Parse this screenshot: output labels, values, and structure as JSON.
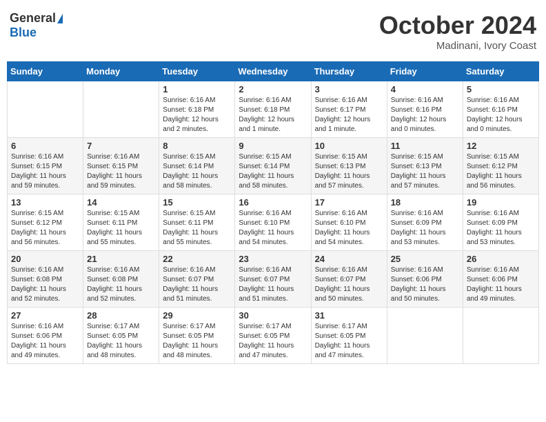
{
  "header": {
    "logo_general": "General",
    "logo_blue": "Blue",
    "month_title": "October 2024",
    "location": "Madinani, Ivory Coast"
  },
  "weekdays": [
    "Sunday",
    "Monday",
    "Tuesday",
    "Wednesday",
    "Thursday",
    "Friday",
    "Saturday"
  ],
  "weeks": [
    [
      {
        "day": "",
        "info": ""
      },
      {
        "day": "",
        "info": ""
      },
      {
        "day": "1",
        "info": "Sunrise: 6:16 AM\nSunset: 6:18 PM\nDaylight: 12 hours\nand 2 minutes."
      },
      {
        "day": "2",
        "info": "Sunrise: 6:16 AM\nSunset: 6:18 PM\nDaylight: 12 hours\nand 1 minute."
      },
      {
        "day": "3",
        "info": "Sunrise: 6:16 AM\nSunset: 6:17 PM\nDaylight: 12 hours\nand 1 minute."
      },
      {
        "day": "4",
        "info": "Sunrise: 6:16 AM\nSunset: 6:16 PM\nDaylight: 12 hours\nand 0 minutes."
      },
      {
        "day": "5",
        "info": "Sunrise: 6:16 AM\nSunset: 6:16 PM\nDaylight: 12 hours\nand 0 minutes."
      }
    ],
    [
      {
        "day": "6",
        "info": "Sunrise: 6:16 AM\nSunset: 6:15 PM\nDaylight: 11 hours\nand 59 minutes."
      },
      {
        "day": "7",
        "info": "Sunrise: 6:16 AM\nSunset: 6:15 PM\nDaylight: 11 hours\nand 59 minutes."
      },
      {
        "day": "8",
        "info": "Sunrise: 6:15 AM\nSunset: 6:14 PM\nDaylight: 11 hours\nand 58 minutes."
      },
      {
        "day": "9",
        "info": "Sunrise: 6:15 AM\nSunset: 6:14 PM\nDaylight: 11 hours\nand 58 minutes."
      },
      {
        "day": "10",
        "info": "Sunrise: 6:15 AM\nSunset: 6:13 PM\nDaylight: 11 hours\nand 57 minutes."
      },
      {
        "day": "11",
        "info": "Sunrise: 6:15 AM\nSunset: 6:13 PM\nDaylight: 11 hours\nand 57 minutes."
      },
      {
        "day": "12",
        "info": "Sunrise: 6:15 AM\nSunset: 6:12 PM\nDaylight: 11 hours\nand 56 minutes."
      }
    ],
    [
      {
        "day": "13",
        "info": "Sunrise: 6:15 AM\nSunset: 6:12 PM\nDaylight: 11 hours\nand 56 minutes."
      },
      {
        "day": "14",
        "info": "Sunrise: 6:15 AM\nSunset: 6:11 PM\nDaylight: 11 hours\nand 55 minutes."
      },
      {
        "day": "15",
        "info": "Sunrise: 6:15 AM\nSunset: 6:11 PM\nDaylight: 11 hours\nand 55 minutes."
      },
      {
        "day": "16",
        "info": "Sunrise: 6:16 AM\nSunset: 6:10 PM\nDaylight: 11 hours\nand 54 minutes."
      },
      {
        "day": "17",
        "info": "Sunrise: 6:16 AM\nSunset: 6:10 PM\nDaylight: 11 hours\nand 54 minutes."
      },
      {
        "day": "18",
        "info": "Sunrise: 6:16 AM\nSunset: 6:09 PM\nDaylight: 11 hours\nand 53 minutes."
      },
      {
        "day": "19",
        "info": "Sunrise: 6:16 AM\nSunset: 6:09 PM\nDaylight: 11 hours\nand 53 minutes."
      }
    ],
    [
      {
        "day": "20",
        "info": "Sunrise: 6:16 AM\nSunset: 6:08 PM\nDaylight: 11 hours\nand 52 minutes."
      },
      {
        "day": "21",
        "info": "Sunrise: 6:16 AM\nSunset: 6:08 PM\nDaylight: 11 hours\nand 52 minutes."
      },
      {
        "day": "22",
        "info": "Sunrise: 6:16 AM\nSunset: 6:07 PM\nDaylight: 11 hours\nand 51 minutes."
      },
      {
        "day": "23",
        "info": "Sunrise: 6:16 AM\nSunset: 6:07 PM\nDaylight: 11 hours\nand 51 minutes."
      },
      {
        "day": "24",
        "info": "Sunrise: 6:16 AM\nSunset: 6:07 PM\nDaylight: 11 hours\nand 50 minutes."
      },
      {
        "day": "25",
        "info": "Sunrise: 6:16 AM\nSunset: 6:06 PM\nDaylight: 11 hours\nand 50 minutes."
      },
      {
        "day": "26",
        "info": "Sunrise: 6:16 AM\nSunset: 6:06 PM\nDaylight: 11 hours\nand 49 minutes."
      }
    ],
    [
      {
        "day": "27",
        "info": "Sunrise: 6:16 AM\nSunset: 6:06 PM\nDaylight: 11 hours\nand 49 minutes."
      },
      {
        "day": "28",
        "info": "Sunrise: 6:17 AM\nSunset: 6:05 PM\nDaylight: 11 hours\nand 48 minutes."
      },
      {
        "day": "29",
        "info": "Sunrise: 6:17 AM\nSunset: 6:05 PM\nDaylight: 11 hours\nand 48 minutes."
      },
      {
        "day": "30",
        "info": "Sunrise: 6:17 AM\nSunset: 6:05 PM\nDaylight: 11 hours\nand 47 minutes."
      },
      {
        "day": "31",
        "info": "Sunrise: 6:17 AM\nSunset: 6:05 PM\nDaylight: 11 hours\nand 47 minutes."
      },
      {
        "day": "",
        "info": ""
      },
      {
        "day": "",
        "info": ""
      }
    ]
  ]
}
